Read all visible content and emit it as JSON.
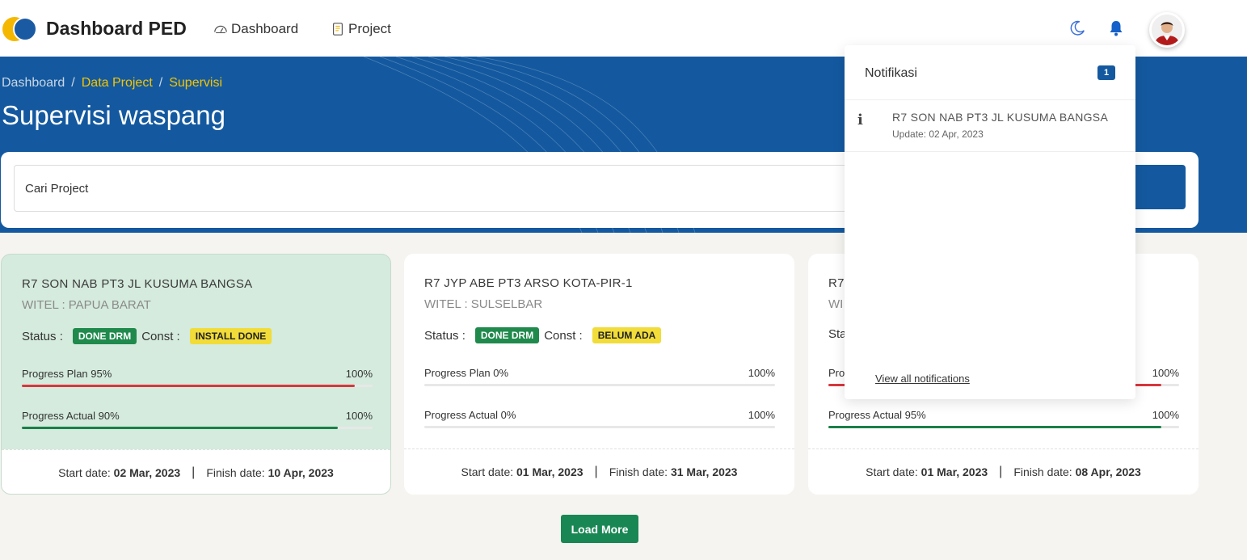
{
  "app": {
    "brand": "Dashboard PED"
  },
  "nav": {
    "dashboard_label": "Dashboard",
    "project_label": "Project"
  },
  "breadcrumb": {
    "item1": "Dashboard",
    "item2": "Data Project",
    "item3": "Supervisi",
    "sep": "/"
  },
  "page_title": "Supervisi waspang",
  "search": {
    "placeholder": "Cari Project"
  },
  "labels": {
    "status": "Status :",
    "const": "Const :",
    "start_date": "Start date:",
    "finish_date": "Finish date:",
    "pipe": "|"
  },
  "cards": [
    {
      "title": "R7 SON NAB PT3 JL KUSUMA BANGSA",
      "witel": "WITEL : PAPUA BARAT",
      "status_badge": "DONE DRM",
      "const_badge": "INSTALL DONE",
      "plan_label": "Progress Plan 95%",
      "plan_max": "100%",
      "plan_value": 95,
      "actual_label": "Progress Actual 90%",
      "actual_max": "100%",
      "actual_value": 90,
      "start": "02 Mar, 2023",
      "finish": "10 Apr, 2023"
    },
    {
      "title": "R7 JYP ABE PT3 ARSO KOTA-PIR-1",
      "witel": "WITEL : SULSELBAR",
      "status_badge": "DONE DRM",
      "const_badge": "BELUM ADA",
      "plan_label": "Progress Plan 0%",
      "plan_max": "100%",
      "plan_value": 0,
      "actual_label": "Progress Actual 0%",
      "actual_max": "100%",
      "actual_value": 0,
      "start": "01 Mar, 2023",
      "finish": "31 Mar, 2023"
    },
    {
      "title": "R7",
      "witel": "WI",
      "status_label_partial": "Sta",
      "plan_label": "Pro",
      "plan_max": "100%",
      "plan_value": 95,
      "actual_label": "Progress Actual 95%",
      "actual_max": "100%",
      "actual_value": 95,
      "start": "01 Mar, 2023",
      "finish": "08 Apr, 2023"
    }
  ],
  "load_more": "Load More",
  "notifications": {
    "title": "Notifikasi",
    "count": "1",
    "items": [
      {
        "text": "R7 SON NAB PT3 JL KUSUMA BANGSA",
        "update": "Update: 02 Apr, 2023",
        "icon": "info-icon"
      }
    ],
    "view_all": "View all notifications"
  },
  "colors": {
    "primary": "#14599f",
    "accent_yellow": "#f5c400",
    "success": "#198754",
    "danger": "#d9363e",
    "highlight_card": "#d4ebdd"
  }
}
